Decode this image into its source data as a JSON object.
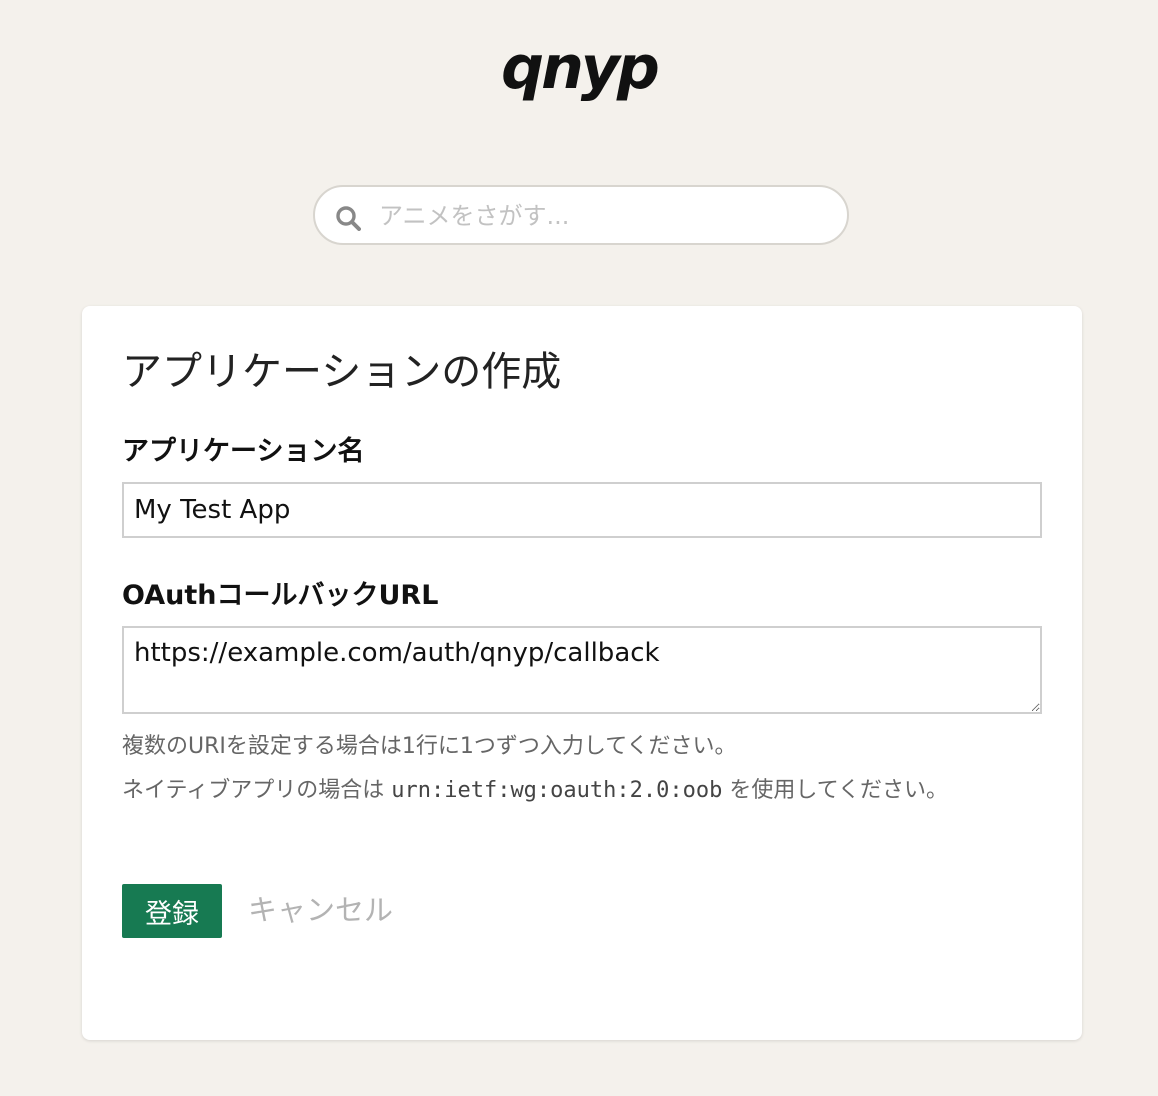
{
  "header": {
    "logo_text": "qnyp"
  },
  "search": {
    "placeholder": "アニメをさがす..."
  },
  "form": {
    "title": "アプリケーションの作成",
    "name_label": "アプリケーション名",
    "name_value": "My Test App",
    "url_label": "OAuthコールバックURL",
    "url_value": "https://example.com/auth/qnyp/callback",
    "help_multi": "複数のURIを設定する場合は1行に1つずつ入力してください。",
    "help_native_prefix": "ネイティブアプリの場合は ",
    "help_native_code": "urn:ietf:wg:oauth:2.0:oob",
    "help_native_suffix": " を使用してください。",
    "submit_label": "登録",
    "cancel_label": "キャンセル"
  },
  "colors": {
    "background": "#f4f1ec",
    "primary_button": "#177a52",
    "cancel_link": "#b3b3b3"
  },
  "icons": {
    "search": "search-icon"
  }
}
